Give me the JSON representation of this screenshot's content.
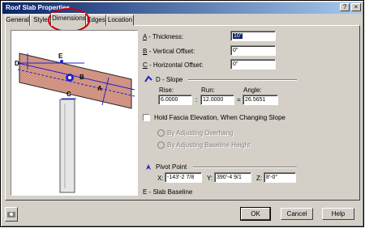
{
  "window": {
    "title": "Roof Slab Properties",
    "help_glyph": "?",
    "close_glyph": "×"
  },
  "tabs": [
    {
      "label": "General"
    },
    {
      "label": "Style"
    },
    {
      "label": "Dimensions"
    },
    {
      "label": "Edges"
    },
    {
      "label": "Location"
    }
  ],
  "preview": {
    "labels": {
      "d": "D",
      "e": "E",
      "b": "B",
      "a": "A",
      "c": "C"
    }
  },
  "dimensions": {
    "thickness": {
      "key": "A",
      "label": " - Thickness:",
      "value": "10\""
    },
    "vertical_offset": {
      "key": "B",
      "label": " - Vertical Offset:",
      "value": "0\""
    },
    "horizontal_offset": {
      "key": "C",
      "label": " - Horizontal Offset:",
      "value": "0\""
    }
  },
  "slope": {
    "title": "D - Slope",
    "rise_label": "Rise:",
    "rise": "6.0000",
    "run_label": "Run:",
    "run": "12.0000",
    "angle_label": "Angle:",
    "angle": "26.5651",
    "colon": ":",
    "equals": "="
  },
  "fascia": {
    "checkbox_label": "Hold Fascia Elevation, When Changing Slope",
    "option1": "By Adjusting Overhang",
    "option2": "By Adjusting Baseline Height"
  },
  "pivot": {
    "title": "Pivot Point",
    "x_label": "X:",
    "x": "-143'-2 7/8",
    "y_label": "Y:",
    "y": "390'-4 9/1",
    "z_label": "Z:",
    "z": "8'-0\""
  },
  "baseline_label": "E - Slab Baseline",
  "buttons": {
    "ok": "OK",
    "cancel": "Cancel",
    "help": "Help"
  },
  "colors": {
    "title_start": "#0a246a",
    "title_end": "#a6caf0",
    "annotation": "#cc0000",
    "dialog": "#d4d0c8"
  }
}
